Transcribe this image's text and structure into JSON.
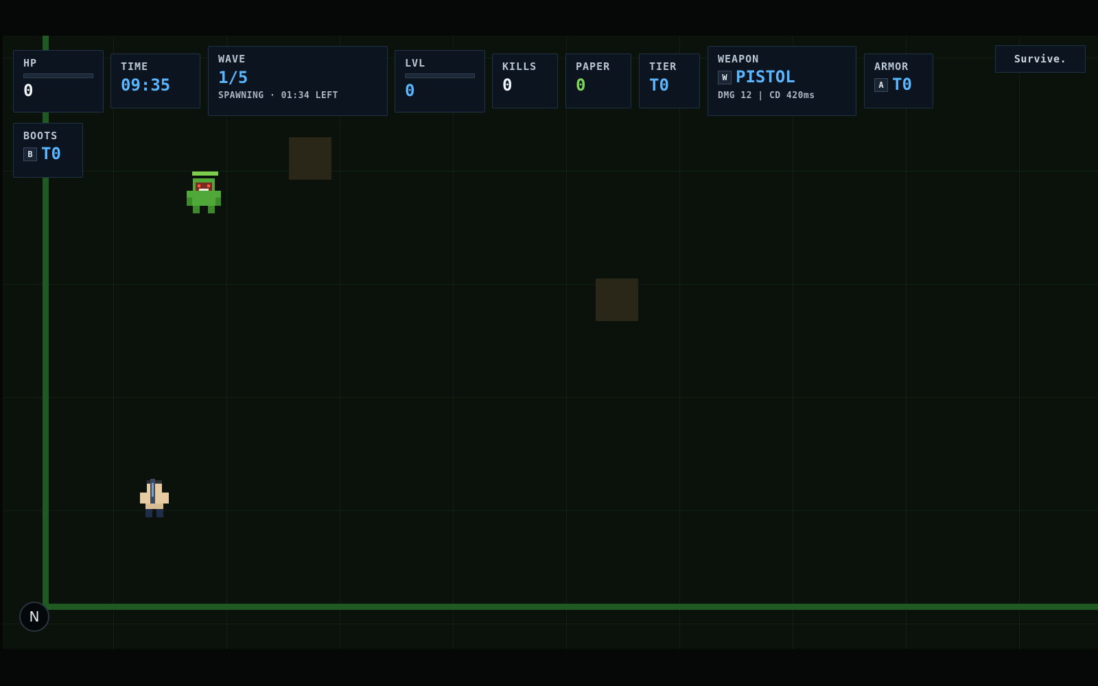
{
  "hud": {
    "hp": {
      "label": "HP",
      "value": "0",
      "fill": 0
    },
    "time": {
      "label": "TIME",
      "value": "09:35"
    },
    "wave": {
      "label": "WAVE",
      "value": "1/5",
      "status": "SPAWNING · 01:34 LEFT"
    },
    "lvl": {
      "label": "LVL",
      "value": "0",
      "fill": 0
    },
    "kills": {
      "label": "KILLS",
      "value": "0"
    },
    "paper": {
      "label": "PAPER",
      "value": "0"
    },
    "tier": {
      "label": "TIER",
      "value": "T0"
    },
    "weapon": {
      "label": "WEAPON",
      "key": "W",
      "value": "PISTOL",
      "stats": "DMG 12 | CD 420ms"
    },
    "armor": {
      "label": "ARMOR",
      "key": "A",
      "value": "T0"
    },
    "boots": {
      "label": "BOOTS",
      "key": "B",
      "value": "T0"
    }
  },
  "objective": "Survive.",
  "compass": "N",
  "entities": {
    "enemy": {
      "icon": "green-orc-icon",
      "health_fill": 1.0
    },
    "player": {
      "icon": "player-gunner-icon"
    }
  },
  "colors": {
    "accent_blue": "#59b6ff",
    "paper_green": "#7fd65a",
    "wall_green": "#1e5a22",
    "panel_bg": "#0c1420"
  }
}
